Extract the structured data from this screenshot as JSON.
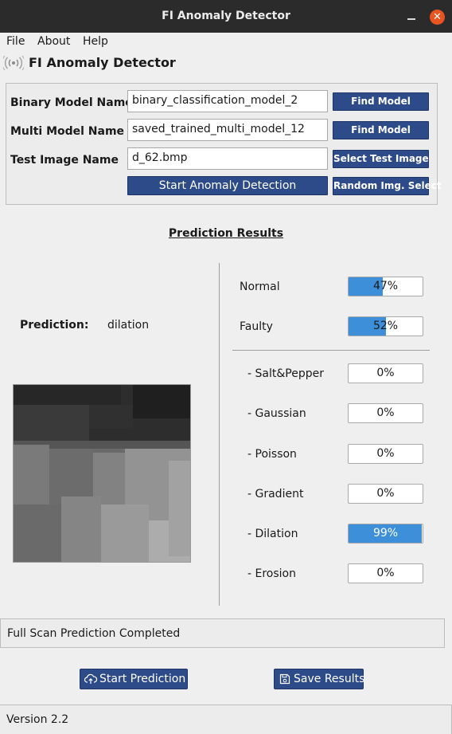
{
  "window": {
    "title": "FI Anomaly Detector",
    "close_glyph": "✕"
  },
  "menu": {
    "file": "File",
    "about": "About",
    "help": "Help"
  },
  "header": {
    "title": "FI Anomaly Detector",
    "icon": "signal-waves-icon"
  },
  "config": {
    "binary_label": "Binary Model Name",
    "binary_value": "binary_classification_model_2",
    "binary_button": "Find Model",
    "multi_label": "Multi Model Name",
    "multi_value": "saved_trained_multi_model_12",
    "multi_button": "Find Model",
    "test_label": "Test Image Name",
    "test_value": "d_62.bmp",
    "test_button": "Select Test Image",
    "start_button": "Start Anomaly Detection",
    "random_button": "Random Img. Select"
  },
  "results": {
    "title": "Prediction Results",
    "prediction_label": "Prediction:",
    "prediction_value": "dilation",
    "normal": {
      "label": "Normal",
      "value": "47%",
      "fraction": 0.47
    },
    "faulty": {
      "label": "Faulty",
      "value": "52%",
      "fraction": 0.52
    },
    "classes": [
      {
        "label": "- Salt&Pepper",
        "value": "0%",
        "fraction": 0
      },
      {
        "label": "- Gaussian",
        "value": "0%",
        "fraction": 0
      },
      {
        "label": "- Poisson",
        "value": "0%",
        "fraction": 0
      },
      {
        "label": "- Gradient",
        "value": "0%",
        "fraction": 0
      },
      {
        "label": "- Dilation",
        "value": "99%",
        "fraction": 0.99
      },
      {
        "label": "- Erosion",
        "value": "0%",
        "fraction": 0
      }
    ]
  },
  "status": {
    "text": "Full Scan Prediction Completed"
  },
  "actions": {
    "start_prediction": "Start Prediction",
    "save_results": "Save Results"
  },
  "footer": {
    "version": "Version 2.2"
  },
  "colors": {
    "accent": "#2e4b89",
    "progress": "#3d8fd9",
    "close": "#e95420",
    "titlebar": "#2b2b2b"
  }
}
